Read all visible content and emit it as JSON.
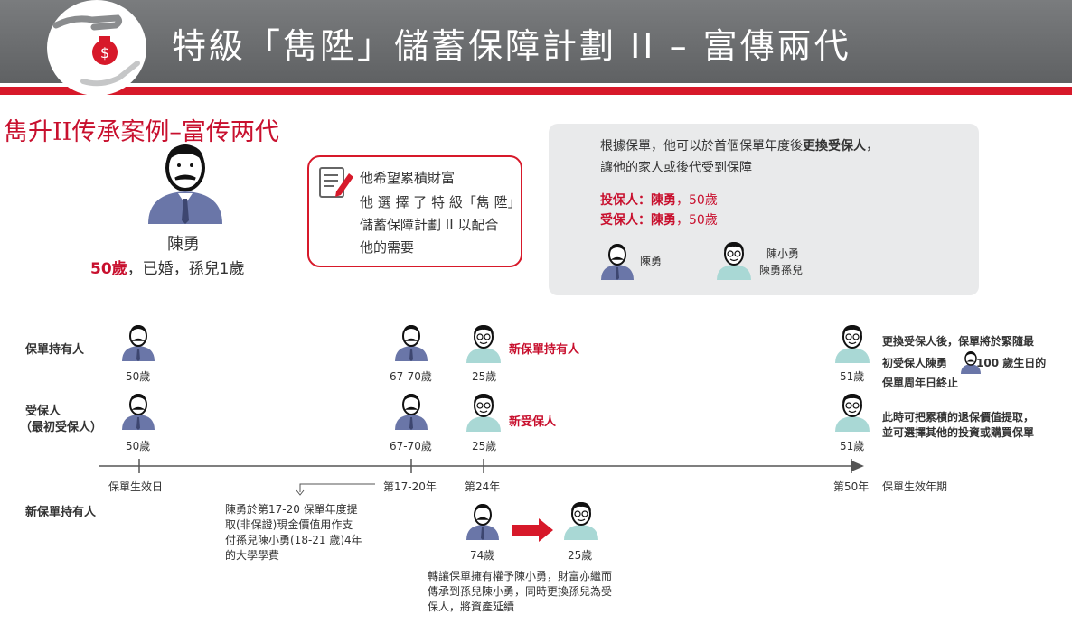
{
  "header": {
    "title": "特級「雋陞」儲蓄保障計劃 II – 富傳兩代"
  },
  "case_title": "雋升II传承案例–富传两代",
  "person": {
    "name": "陳勇",
    "age": "50歲",
    "details": "，已婚，孫兒1歲"
  },
  "wish": {
    "line1": "他希望累積財富",
    "line2": "他 選 擇 了 特 級「雋 陞」",
    "line3": "儲蓄保障計劃 II 以配合",
    "line4": "他的需要"
  },
  "info": {
    "line1_pre": "根據保單，他可以於首個保單年度後",
    "line1_bold": "更換受保人",
    "line1_post": "，",
    "line2": "讓他的家人或後代受到保障",
    "policyholder_label": "投保人：陳勇",
    "policyholder_age": "，50歲",
    "insured_label": "受保人：陳勇",
    "insured_age": "，50歲",
    "person1": "陳勇",
    "person2_name": "陳小勇",
    "person2_relation": "陳勇孫兒"
  },
  "rows": {
    "policyholder": "保單持有人",
    "insured_line1": "受保人",
    "insured_line2": "（最初受保人）",
    "new_holder": "新保單持有人"
  },
  "ages": {
    "r1_a": "50歲",
    "r1_b": "67-70歲",
    "r1_c": "25歲",
    "r1_d": "51歲",
    "r2_a": "50歲",
    "r2_b": "67-70歲",
    "r2_c": "25歲",
    "r2_d": "51歲",
    "new_a": "74歲",
    "new_b": "25歲"
  },
  "tags": {
    "new_holder": "新保單持有人",
    "new_insured": "新受保人"
  },
  "timeline": {
    "start": "保單生效日",
    "y17": "第17-20年",
    "y24": "第24年",
    "y50": "第50年",
    "end": "保單生效年期"
  },
  "notes": {
    "r1_line1": "更換受保人後，保單將於緊隨最",
    "r1_line2_pre": "初受保人陳勇",
    "r1_line2_post": "100 歲生日的",
    "r1_line3": "保單周年日終止",
    "r2_line1": "此時可把累積的退保價值提取，",
    "r2_line2": "並可選擇其他的投資或購買保單",
    "edu_1": "陳勇於第17-20 保單年度提",
    "edu_2": "取(非保證)現金價值用作支",
    "edu_3": "付孫兒陳小勇(18-21 歲)4年",
    "edu_4": "的大學學費",
    "transfer_1": "轉讓保單擁有權予陳小勇，財富亦繼而",
    "transfer_2": "傳承到孫兒陳小勇，同時更換孫兒為受",
    "transfer_3": "保人，將資產延續"
  },
  "colors": {
    "brand_red": "#d7192a",
    "header_gray": "#6b6d6f",
    "man_blue": "#6a76a8",
    "boy_teal": "#a9d8d5"
  }
}
